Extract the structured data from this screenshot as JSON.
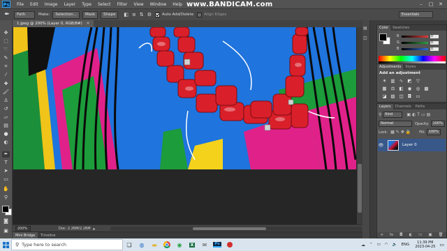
{
  "app": {
    "logo": "Ps",
    "menu": [
      "File",
      "Edit",
      "Image",
      "Layer",
      "Type",
      "Select",
      "Filter",
      "View",
      "Window",
      "Help"
    ],
    "watermark": "www.BANDICAM.com",
    "window_controls": [
      "–",
      "□",
      "✕"
    ]
  },
  "options_bar": {
    "tool_mode": "Path",
    "make_label": "Make:",
    "buttons": [
      "Selection...",
      "Mask",
      "Shape"
    ],
    "auto_add_delete": "Auto Add/Delete",
    "align_edges": "Align Edges",
    "workspace": "Essentials"
  },
  "document": {
    "tab_title": "1.jpeg @ 200% (Layer 0, RGB/8#)",
    "zoom": "200%",
    "doc_info": "Doc: 2.26M/2.26M"
  },
  "bottom_tabs": [
    "Mini Bridge",
    "Timeline"
  ],
  "color_panel": {
    "tabs": [
      "Color",
      "Swatches"
    ],
    "channels": [
      {
        "label": "R",
        "value": "0",
        "color": "#e23c3c"
      },
      {
        "label": "G",
        "value": "0",
        "color": "#2ea043"
      },
      {
        "label": "B",
        "value": "0",
        "color": "#2f6de0"
      }
    ]
  },
  "adjustments_panel": {
    "tabs": [
      "Adjustments",
      "Styles"
    ],
    "heading": "Add an adjustment"
  },
  "layers_panel": {
    "tabs": [
      "Layers",
      "Channels",
      "Paths"
    ],
    "kind_filter": "Kind",
    "blend_mode": "Normal",
    "opacity_label": "Opacity:",
    "opacity_value": "100%",
    "lock_label": "Lock:",
    "fill_label": "Fill:",
    "fill_value": "100%",
    "layers": [
      {
        "name": "Layer 0",
        "visible": true
      }
    ]
  },
  "taskbar": {
    "search_placeholder": "Type here to search",
    "tray": {
      "language": "ENG",
      "time": "11:39 PM",
      "date": "2023-04-25"
    }
  }
}
